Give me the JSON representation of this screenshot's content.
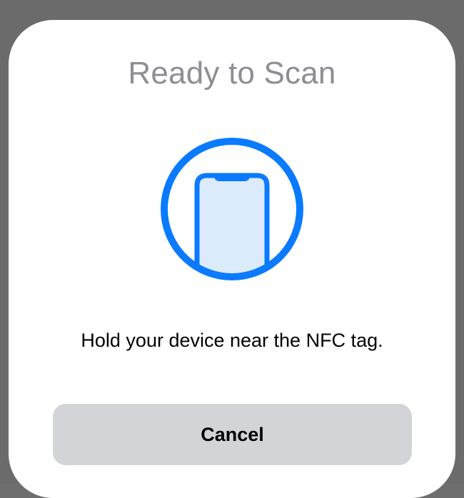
{
  "dialog": {
    "title": "Ready to Scan",
    "icon": "phone-scan-icon",
    "message": "Hold your device near the NFC tag.",
    "cancel_label": "Cancel"
  },
  "colors": {
    "accent": "#0a7aff",
    "phone_fill": "#dcebfc",
    "button_bg": "#d3d4d8",
    "title_text": "#8e8e93",
    "backdrop": "#6b6b6b"
  }
}
